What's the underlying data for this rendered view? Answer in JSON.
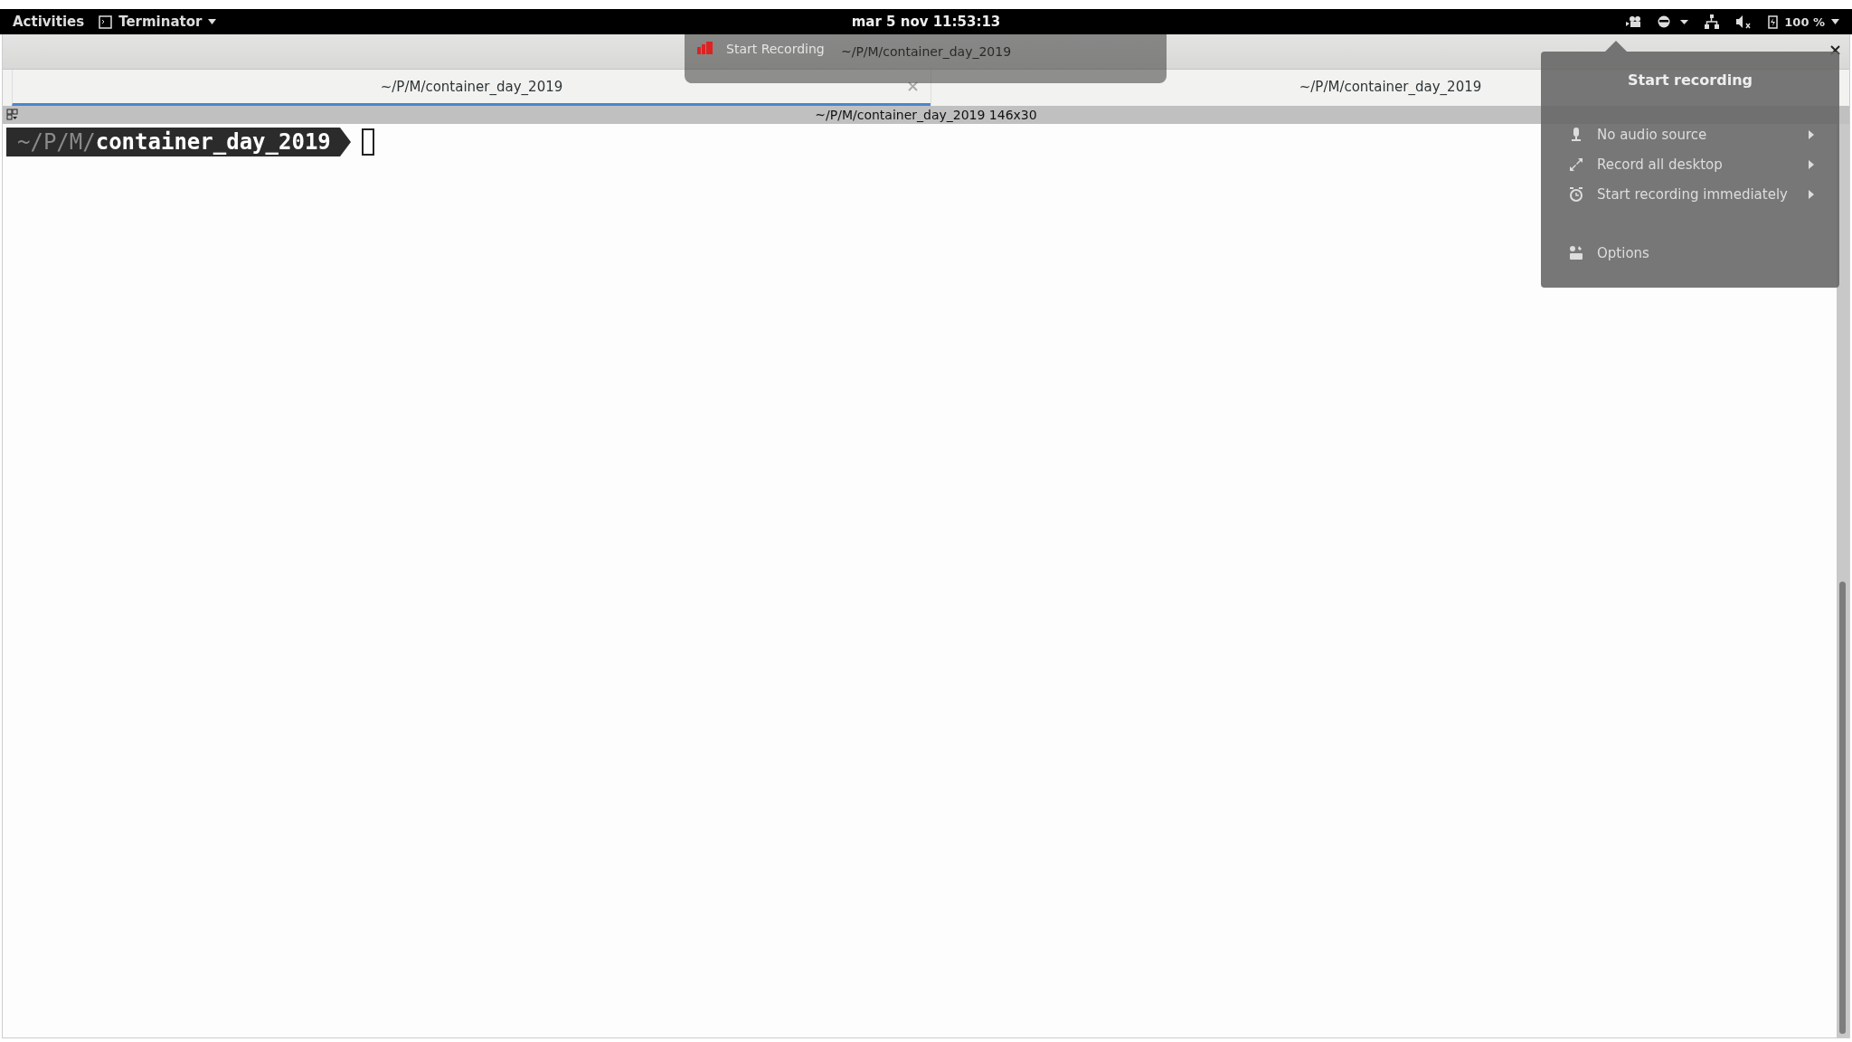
{
  "top_bar": {
    "activities": "Activities",
    "app_menu": "Terminator",
    "clock": "mar 5 nov  11:53:13",
    "battery": "100 %"
  },
  "window": {
    "title": "~/P/M/container_day_2019"
  },
  "notification": {
    "text": "Start Recording"
  },
  "tabs": [
    {
      "label": "~/P/M/container_day_2019",
      "selected": true
    },
    {
      "label": "~/P/M/container_day_2019",
      "selected": false
    }
  ],
  "terminal": {
    "title": "~/P/M/container_day_2019 146x30",
    "prompt_dim": "~/P/M/",
    "prompt_dir": "container_day_2019"
  },
  "popup": {
    "title": "Start recording",
    "items": [
      {
        "kind": "submenu",
        "label": "No audio source"
      },
      {
        "kind": "submenu",
        "label": "Record all desktop"
      },
      {
        "kind": "submenu",
        "label": "Start recording immediately"
      },
      {
        "kind": "action",
        "label": "Options"
      }
    ]
  }
}
